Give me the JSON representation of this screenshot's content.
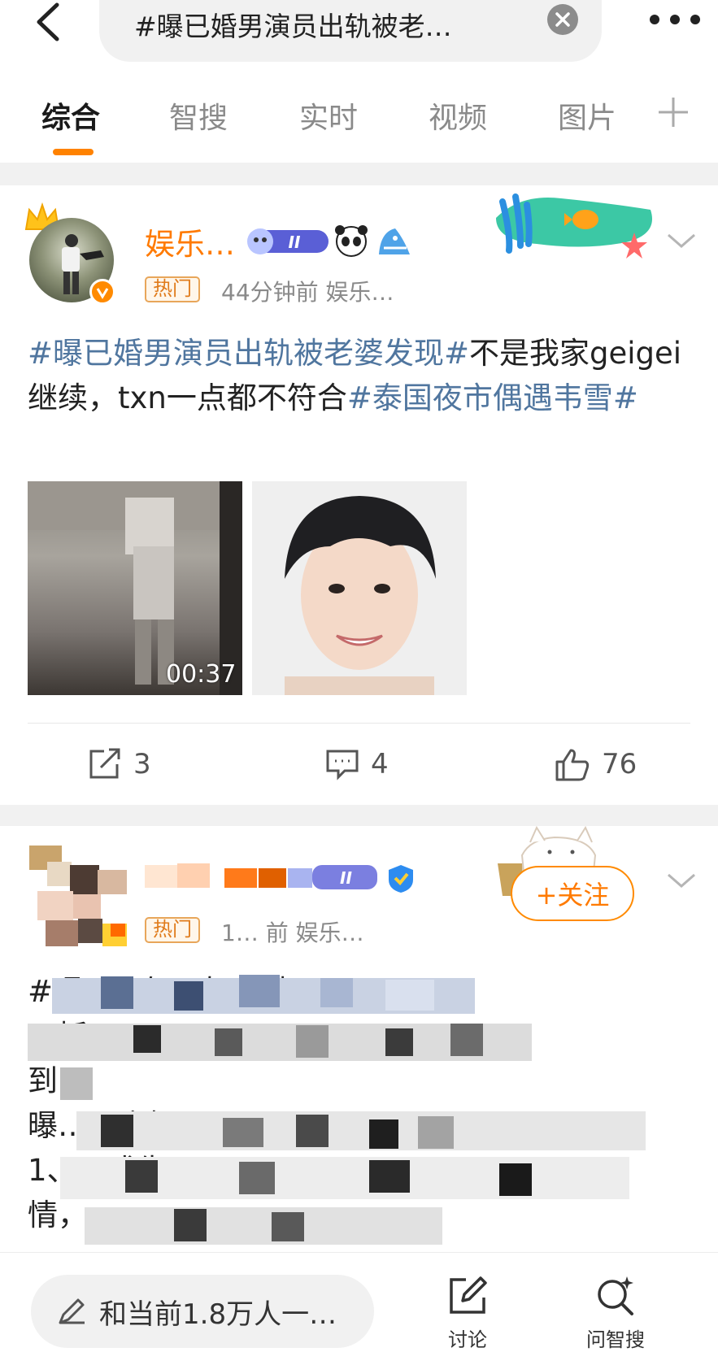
{
  "search": {
    "query": "#曝已婚男演员出轨被老…"
  },
  "tabs": [
    {
      "label": "综合",
      "active": true
    },
    {
      "label": "智搜",
      "active": false
    },
    {
      "label": "实时",
      "active": false
    },
    {
      "label": "视频",
      "active": false
    },
    {
      "label": "图片",
      "active": false
    }
  ],
  "post1": {
    "author": "娱乐…",
    "hot_tag": "热门",
    "meta": "44分钟前  娱乐…",
    "text_parts": [
      {
        "text": "#曝已婚男演员出轨被老婆发现#",
        "topic": true
      },
      {
        "text": "不是我家geigei继续，txn一点都不符合",
        "topic": false
      },
      {
        "text": "#泰国夜市偶遇韦雪#",
        "topic": true
      }
    ],
    "video_duration": "00:37",
    "stats": {
      "reposts": "3",
      "comments": "4",
      "likes": "76"
    }
  },
  "post2": {
    "hot_tag": "热门",
    "meta": "1… 前  娱乐…",
    "follow_label": "+关注",
    "text_visible": "#曝…#有网友曝料\n…抓\n到\n曝…几点提…\n1、…戏生\n情，…"
  },
  "bottom": {
    "comment_placeholder": "和当前1.8万人一…",
    "discuss_label": "讨论",
    "ask_label": "问智搜"
  },
  "colors": {
    "accent": "#ff8200",
    "topic_link": "#50769f",
    "name_orange": "#ff7a00",
    "background_gap": "#f1f1f1"
  }
}
